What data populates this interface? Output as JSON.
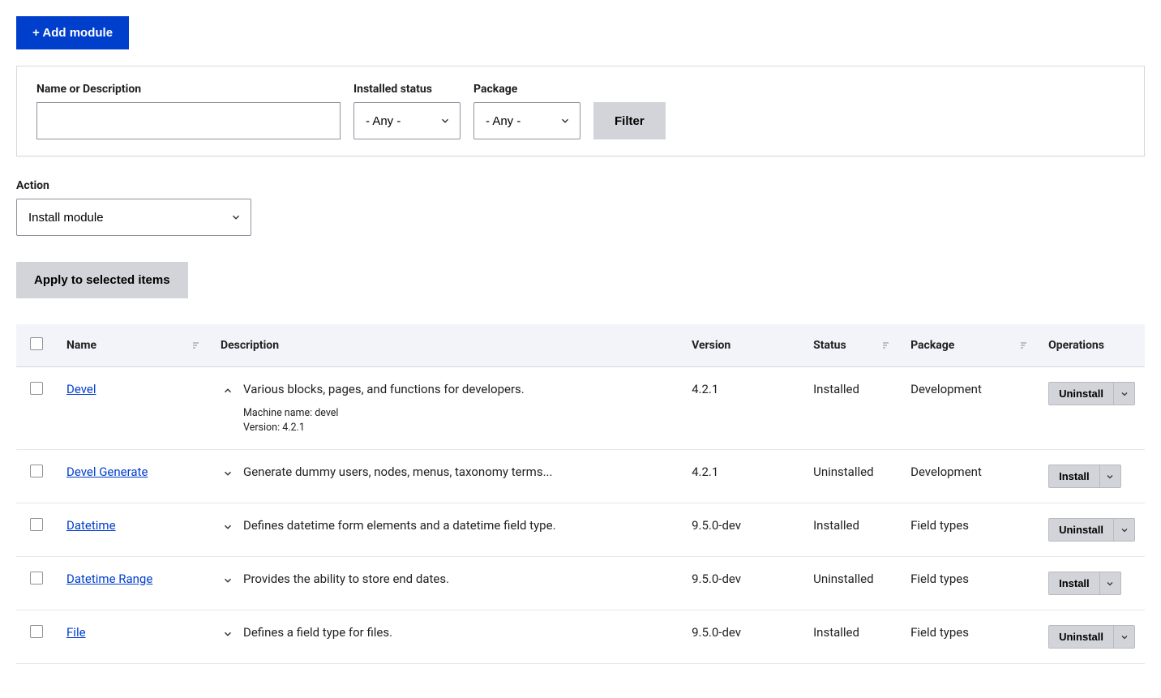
{
  "add_module_btn": "+ Add module",
  "filters": {
    "name_label": "Name or Description",
    "name_value": "",
    "status_label": "Installed status",
    "status_value": "- Any -",
    "package_label": "Package",
    "package_value": "- Any -",
    "filter_btn": "Filter"
  },
  "action": {
    "label": "Action",
    "value": "Install module",
    "apply_btn": "Apply to selected items"
  },
  "table": {
    "headers": {
      "name": "Name",
      "description": "Description",
      "version": "Version",
      "status": "Status",
      "package": "Package",
      "operations": "Operations"
    },
    "rows": [
      {
        "name": "Devel",
        "expanded": true,
        "description": "Various blocks, pages, and functions for developers.",
        "machine_name_label": "Machine name: devel",
        "version_meta": "Version: 4.2.1",
        "version": "4.2.1",
        "status": "Installed",
        "package": "Development",
        "op": "Uninstall"
      },
      {
        "name": "Devel Generate",
        "expanded": false,
        "description": "Generate dummy users, nodes, menus, taxonomy terms...",
        "version": "4.2.1",
        "status": "Uninstalled",
        "package": "Development",
        "op": "Install"
      },
      {
        "name": "Datetime",
        "expanded": false,
        "description": "Defines datetime form elements and a datetime field type.",
        "version": "9.5.0-dev",
        "status": "Installed",
        "package": "Field types",
        "op": "Uninstall"
      },
      {
        "name": "Datetime Range",
        "expanded": false,
        "description": "Provides the ability to store end dates.",
        "version": "9.5.0-dev",
        "status": "Uninstalled",
        "package": "Field types",
        "op": "Install"
      },
      {
        "name": "File",
        "expanded": false,
        "description": "Defines a field type for files.",
        "version": "9.5.0-dev",
        "status": "Installed",
        "package": "Field types",
        "op": "Uninstall"
      }
    ]
  }
}
